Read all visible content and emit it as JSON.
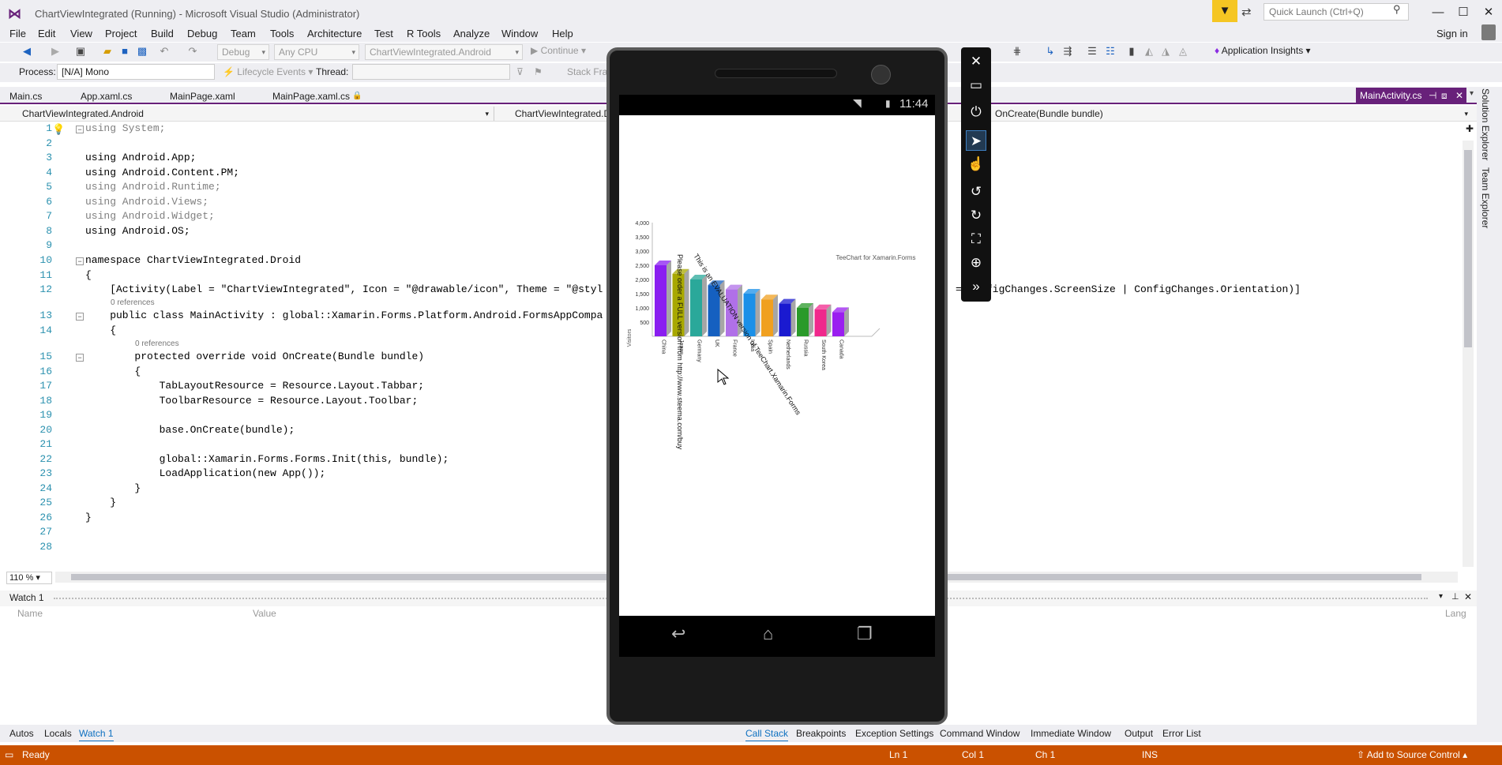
{
  "window": {
    "title": "ChartViewIntegrated (Running) - Microsoft Visual Studio  (Administrator)",
    "quick_launch_placeholder": "Quick Launch (Ctrl+Q)",
    "sign_in": "Sign in"
  },
  "menu": [
    "File",
    "Edit",
    "View",
    "Project",
    "Build",
    "Debug",
    "Team",
    "Tools",
    "Architecture",
    "Test",
    "R Tools",
    "Analyze",
    "Window",
    "Help"
  ],
  "toolbar": {
    "config": "Debug",
    "platform": "Any CPU",
    "startup_project": "ChartViewIntegrated.Android",
    "continue": "Continue",
    "app_insights": "Application Insights"
  },
  "debug_location": {
    "process_label": "Process:",
    "process_value": "[N/A] Mono",
    "lifecycle": "Lifecycle Events",
    "thread_label": "Thread:",
    "stack_frame": "Stack Fram"
  },
  "tabs": [
    "Main.cs",
    "App.xaml.cs",
    "MainPage.xaml",
    "MainPage.xaml.cs"
  ],
  "active_tab": "MainActivity.cs",
  "nav": {
    "project": "ChartViewIntegrated.Android",
    "type": "ChartViewIntegrated.D",
    "member": "OnCreate(Bundle bundle)"
  },
  "code": {
    "l1": "using System;",
    "l3": "using Android.App;",
    "l4": "using Android.Content.PM;",
    "l5": "using Android.Runtime;",
    "l6": "using Android.Views;",
    "l7": "using Android.Widget;",
    "l8": "using Android.OS;",
    "l10": "namespace ChartViewIntegrated.Droid",
    "l11": "{",
    "l12a": "    [Activity(Label = \"ChartViewIntegrated\", Icon = \"@drawable/icon\", Theme = \"@styl",
    "l12b": "= ConfigChanges.ScreenSize | ConfigChanges.Orientation)]",
    "ref1": "0 references",
    "l13": "    public class MainActivity : global::Xamarin.Forms.Platform.Android.FormsAppCompa",
    "l14": "    {",
    "ref2": "0 references",
    "l15": "        protected override void OnCreate(Bundle bundle)",
    "l16": "        {",
    "l17": "            TabLayoutResource = Resource.Layout.Tabbar;",
    "l18": "            ToolbarResource = Resource.Layout.Toolbar;",
    "l20": "            base.OnCreate(bundle);",
    "l22": "            global::Xamarin.Forms.Forms.Init(this, bundle);",
    "l23": "            LoadApplication(new App());",
    "l24": "        }",
    "l25": "    }",
    "l26": "}"
  },
  "editor": {
    "zoom": "110 %"
  },
  "right_strip": [
    "Solution Explorer",
    "Team Explorer"
  ],
  "watch": {
    "title": "Watch 1",
    "columns": [
      "Name",
      "Value",
      "Lang"
    ]
  },
  "bottom_left_tabs": [
    "Autos",
    "Locals",
    "Watch 1"
  ],
  "bottom_right_tabs": [
    "Call Stack",
    "Breakpoints",
    "Exception Settings",
    "Command Window",
    "Immediate Window",
    "Output",
    "Error List"
  ],
  "status": {
    "ready": "Ready",
    "ln": "Ln 1",
    "col": "Col 1",
    "ch": "Ch 1",
    "ins": "INS",
    "source_control": "Add to Source Control"
  },
  "phone": {
    "time": "11:44"
  },
  "chart_data": {
    "type": "bar",
    "title": "TeeChart for Xamarin.Forms",
    "ylabel": "Visitors",
    "ylim": [
      0,
      4000
    ],
    "yticks": [
      500,
      1000,
      1500,
      2000,
      2500,
      3000,
      3500,
      4000
    ],
    "ytick_labels": [
      "500",
      "1,000",
      "1,500",
      "2,000",
      "2,500",
      "3,000",
      "3,500",
      "4,000"
    ],
    "categories": [
      "China",
      "Japan",
      "Germany",
      "UK",
      "France",
      "India",
      "Spain",
      "Netherlands",
      "Russia",
      "South Korea",
      "Canada"
    ],
    "values": [
      2500,
      2200,
      2000,
      1800,
      1650,
      1500,
      1300,
      1150,
      1000,
      950,
      850
    ],
    "colors": [
      "#8a1ef0",
      "#a8a800",
      "#2aa89a",
      "#1560c0",
      "#b070e8",
      "#1a90e8",
      "#f0a020",
      "#1a1ad0",
      "#2a9a2a",
      "#f0288c",
      "#9a1ef0"
    ],
    "watermark1": "This is an EVALUATION version of TeeChart.Xamarin.Forms",
    "watermark2": "Please order a FULL version from http://www.steema.com/buy"
  }
}
